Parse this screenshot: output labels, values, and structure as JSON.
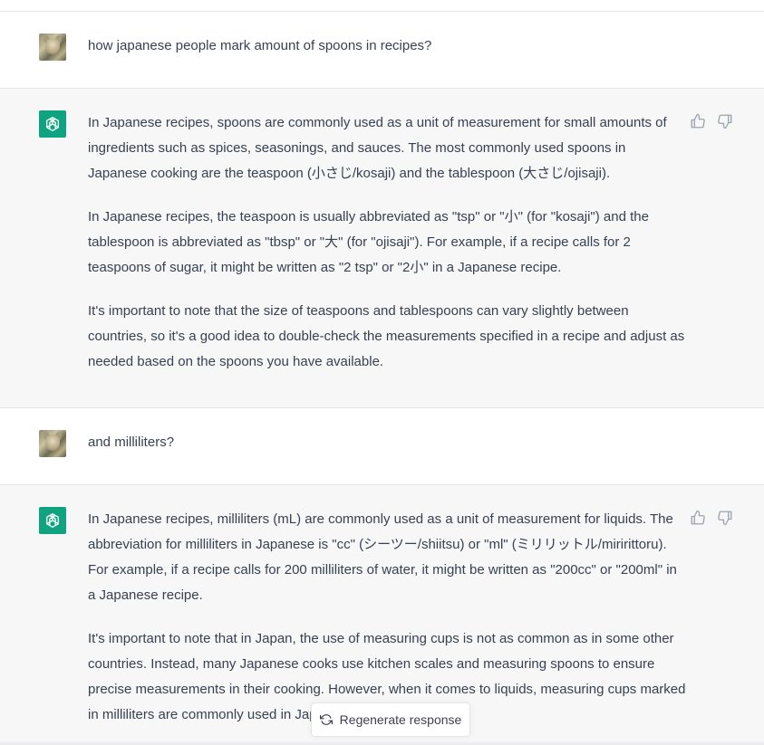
{
  "conversation": {
    "messages": [
      {
        "role": "user",
        "paragraphs": [
          "how japanese people mark amount of spoons in recipes?"
        ]
      },
      {
        "role": "assistant",
        "paragraphs": [
          "In Japanese recipes, spoons are commonly used as a unit of measurement for small amounts of ingredients such as spices, seasonings, and sauces. The most commonly used spoons in Japanese cooking are the teaspoon (小さじ/kosaji) and the tablespoon (大さじ/ojisaji).",
          "In Japanese recipes, the teaspoon is usually abbreviated as \"tsp\" or \"小\" (for \"kosaji\") and the tablespoon is abbreviated as \"tbsp\" or \"大\" (for \"ojisaji\"). For example, if a recipe calls for 2 teaspoons of sugar, it might be written as \"2 tsp\" or \"2小\" in a Japanese recipe.",
          "It's important to note that the size of teaspoons and tablespoons can vary slightly between countries, so it's a good idea to double-check the measurements specified in a recipe and adjust as needed based on the spoons you have available."
        ]
      },
      {
        "role": "user",
        "paragraphs": [
          "and milliliters?"
        ]
      },
      {
        "role": "assistant",
        "paragraphs": [
          "In Japanese recipes, milliliters (mL) are commonly used as a unit of measurement for liquids. The abbreviation for milliliters in Japanese is \"cc\" (シーツー/shiitsu) or \"ml\" (ミリリットル/miririttoru). For example, if a recipe calls for 200 milliliters of water, it might be written as \"200cc\" or \"200ml\" in a Japanese recipe.",
          "It's important to note that in Japan, the use of measuring cups is not as common as in some other countries. Instead, many Japanese cooks use kitchen scales and measuring spoons to ensure precise measurements in their cooking. However, when it comes to liquids, measuring cups marked in milliliters are commonly used in Japan."
        ]
      }
    ]
  },
  "regenerate": {
    "label": "Regenerate response",
    "icon": "refresh-icon"
  },
  "colors": {
    "assistant_avatar": "#10a37f",
    "assistant_bg": "#f7f7f8",
    "user_bg": "#ffffff",
    "text": "#374151"
  }
}
